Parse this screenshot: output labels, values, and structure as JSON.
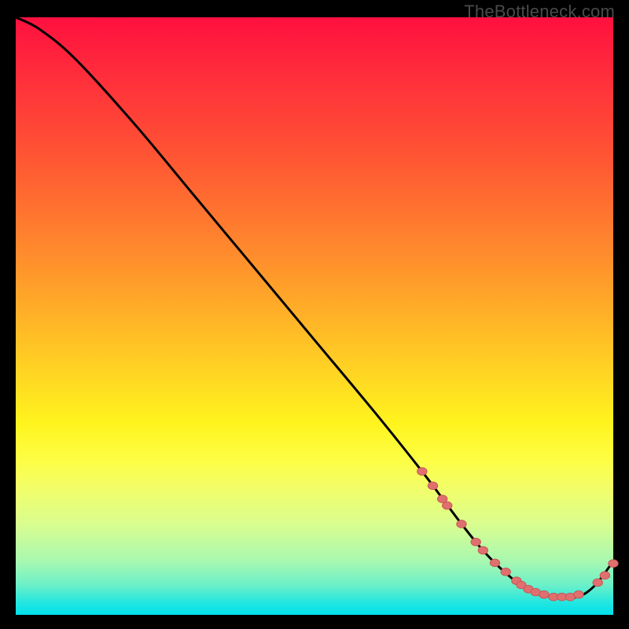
{
  "watermark": "TheBottleneck.com",
  "colors": {
    "background": "#000000",
    "curve_stroke": "#000000",
    "marker_fill": "#e07070",
    "marker_stroke": "#c85858"
  },
  "chart_data": {
    "type": "line",
    "title": "",
    "xlabel": "",
    "ylabel": "",
    "xlim": [
      0,
      100
    ],
    "ylim": [
      0,
      100
    ],
    "grid": false,
    "curve": {
      "x": [
        0,
        4,
        10,
        20,
        30,
        40,
        50,
        60,
        68,
        74,
        78,
        82,
        86,
        90,
        94,
        97,
        100
      ],
      "y": [
        100,
        98,
        93,
        82,
        70,
        58,
        46,
        34,
        24,
        16,
        11,
        7,
        4,
        3,
        3,
        5,
        9
      ]
    },
    "markers": [
      {
        "x": 68.0,
        "y": 24.0
      },
      {
        "x": 69.8,
        "y": 21.6
      },
      {
        "x": 71.4,
        "y": 19.4
      },
      {
        "x": 72.2,
        "y": 18.3
      },
      {
        "x": 74.6,
        "y": 15.2
      },
      {
        "x": 77.0,
        "y": 12.2
      },
      {
        "x": 78.2,
        "y": 10.8
      },
      {
        "x": 80.2,
        "y": 8.7
      },
      {
        "x": 82.0,
        "y": 7.2
      },
      {
        "x": 83.8,
        "y": 5.7
      },
      {
        "x": 84.6,
        "y": 5.0
      },
      {
        "x": 85.8,
        "y": 4.3
      },
      {
        "x": 87.0,
        "y": 3.8
      },
      {
        "x": 88.4,
        "y": 3.4
      },
      {
        "x": 90.0,
        "y": 3.0
      },
      {
        "x": 91.4,
        "y": 3.0
      },
      {
        "x": 92.8,
        "y": 3.0
      },
      {
        "x": 94.2,
        "y": 3.4
      },
      {
        "x": 97.4,
        "y": 5.4
      },
      {
        "x": 98.6,
        "y": 6.6
      },
      {
        "x": 100.0,
        "y": 8.6
      }
    ]
  }
}
